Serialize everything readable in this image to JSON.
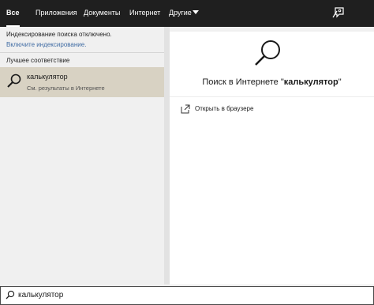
{
  "tabs": [
    {
      "label": "Все",
      "active": true
    },
    {
      "label": "Приложения"
    },
    {
      "label": "Документы"
    },
    {
      "label": "Интернет"
    },
    {
      "label": "Другие"
    }
  ],
  "notice": {
    "text": "Индексирование поиска отключено.",
    "link": "Включите индексирование."
  },
  "best_match": {
    "heading": "Лучшее соответствие",
    "title": "калькулятор",
    "subtitle": "См. результаты в Интернете",
    "icon": "search-icon"
  },
  "preview": {
    "title_prefix": "Поиск в Интернете \"",
    "query": "калькулятор",
    "title_suffix": "\"",
    "action_label": "Открыть в браузере",
    "action_icon": "open-in-browser-icon"
  },
  "search": {
    "value": "калькулятор",
    "icon": "search-icon"
  },
  "colors": {
    "topbar": "#1f1f1f",
    "selected_item": "#d8d2c3",
    "link": "#3f6ba3"
  }
}
